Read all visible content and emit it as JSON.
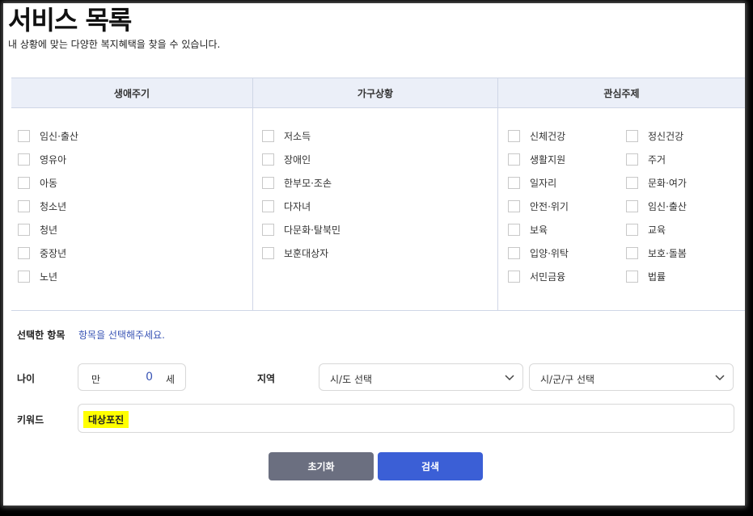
{
  "page": {
    "title": "서비스 목록",
    "subtitle": "내 상황에 맞는 다양한 복지혜택을 찾을 수 있습니다."
  },
  "filters": {
    "life_cycle": {
      "header": "생애주기",
      "options": [
        "임신·출산",
        "영유아",
        "아동",
        "청소년",
        "청년",
        "중장년",
        "노년"
      ]
    },
    "household": {
      "header": "가구상황",
      "options": [
        "저소득",
        "장애인",
        "한부모·조손",
        "다자녀",
        "다문화·탈북민",
        "보훈대상자"
      ]
    },
    "interest": {
      "header": "관심주제",
      "options_left": [
        "신체건강",
        "생활지원",
        "일자리",
        "안전·위기",
        "보육",
        "입양·위탁",
        "서민금융"
      ],
      "options_right": [
        "정신건강",
        "주거",
        "문화·여가",
        "임신·출산",
        "교육",
        "보호·돌봄",
        "법률"
      ]
    }
  },
  "selected": {
    "label": "선택한 항목",
    "hint": "항목을 선택해주세요."
  },
  "age": {
    "label": "나이",
    "prefix": "만",
    "value": "0",
    "suffix": "세"
  },
  "region": {
    "label": "지역",
    "sido": "시/도 선택",
    "gugun": "시/군/구 선택"
  },
  "keyword": {
    "label": "키워드",
    "value": "대상포진"
  },
  "buttons": {
    "reset": "초기화",
    "search": "검색"
  },
  "colors": {
    "header_bg": "#ebeff8",
    "reset_button": "#6b6f80",
    "search_button": "#3b5fd6",
    "hint_text": "#3a55b5",
    "keyword_highlight": "#ffff00"
  },
  "icons": {
    "dropdown": "chevron-down-icon"
  }
}
